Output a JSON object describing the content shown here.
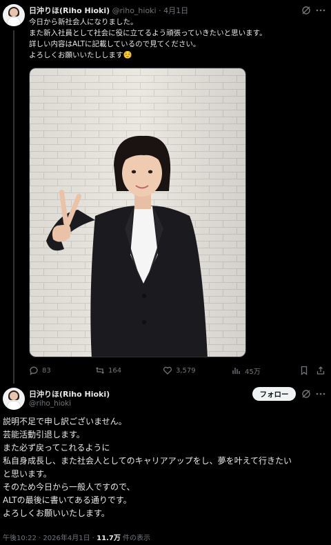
{
  "tweet1": {
    "display_name": "日沖りほ(Riho Hioki)",
    "handle": "@riho_hioki",
    "separator": "·",
    "date": "4月1日",
    "lines": [
      "今日から新社会人になりました。",
      "また新入社員として社会に役に立てるよう頑張っていきたいと思います。",
      "詳しい内容はALTに記載しているので見てください。",
      "よろしくお願いいたしします☺️"
    ],
    "stats": {
      "replies": "83",
      "reposts": "164",
      "likes": "3,579",
      "views": "45万"
    }
  },
  "tweet2": {
    "display_name": "日沖りほ(Riho Hioki)",
    "handle": "@riho_hioki",
    "follow_label": "フォロー",
    "lines": [
      "説明不足で申し訳ございません。",
      "芸能活動引退します。",
      "また必ず戻ってこれるように",
      "私自身成長し、また社会人としてのキャリアアップをし、夢を叶えて行きたい",
      "と思います。",
      "そのため今日から一般人ですので、",
      "ALTの最後に書いてある通りです。",
      "よろしくお願いいたします。"
    ],
    "meta": {
      "time": "午後10:22",
      "separator": "·",
      "date": "2026年4月1日",
      "views_count": "11.7万",
      "views_label": "件の表示"
    }
  },
  "colors": {
    "background": "#000000",
    "text": "#e7e9ea",
    "muted": "#71767b",
    "follow_bg": "#eff3f4",
    "thread_line": "#333639"
  },
  "icons": [
    "grok-icon",
    "more-icon",
    "reply-icon",
    "repost-icon",
    "like-icon",
    "views-icon",
    "bookmark-icon",
    "share-icon"
  ]
}
